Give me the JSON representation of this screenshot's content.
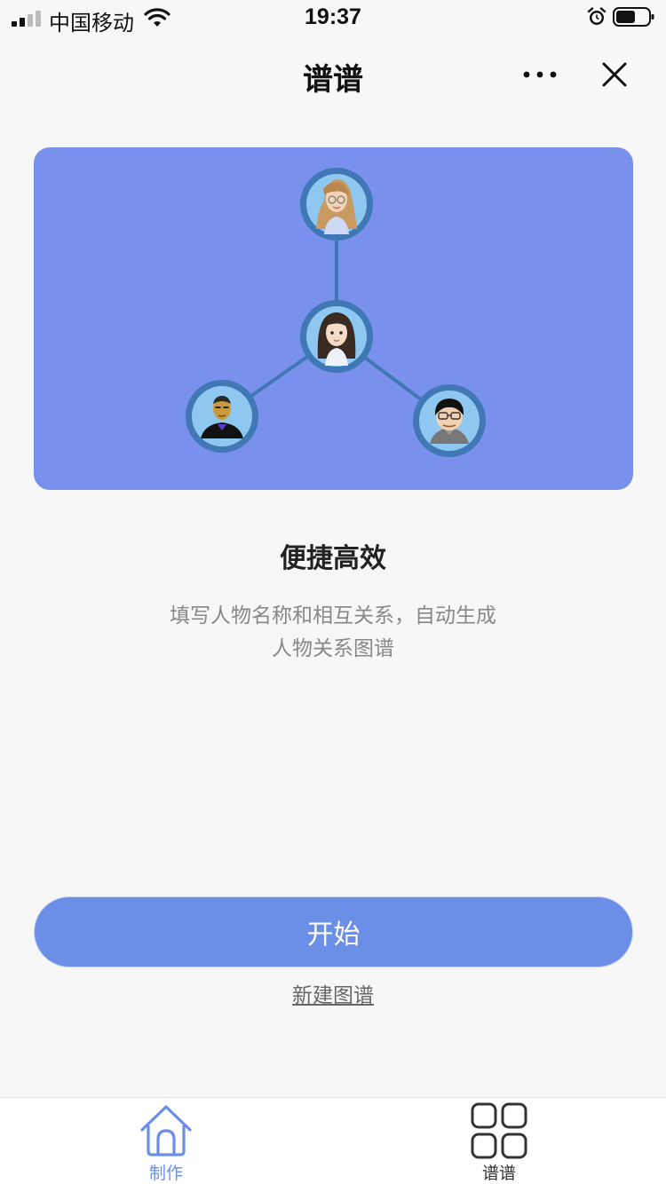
{
  "status_bar": {
    "carrier": "中国移动",
    "time": "19:37"
  },
  "nav": {
    "title": "谱谱",
    "more_icon": "more-dots-icon",
    "close_icon": "close-icon"
  },
  "hero": {
    "bg_color": "#7990ec",
    "avatars": [
      "woman-with-glasses-avatar",
      "woman-avatar",
      "bald-man-avatar",
      "man-with-glasses-avatar"
    ]
  },
  "feature": {
    "title": "便捷高效",
    "desc_line1": "填写人物名称和相互关系，自动生成",
    "desc_line2": "人物关系图谱"
  },
  "actions": {
    "start_label": "开始",
    "new_graph_label": "新建图谱"
  },
  "colors": {
    "accent": "#6b8ee6"
  },
  "tab_bar": {
    "tabs": [
      {
        "label": "制作",
        "icon": "home-icon",
        "active": true
      },
      {
        "label": "谱谱",
        "icon": "grid-icon",
        "active": false
      }
    ]
  }
}
